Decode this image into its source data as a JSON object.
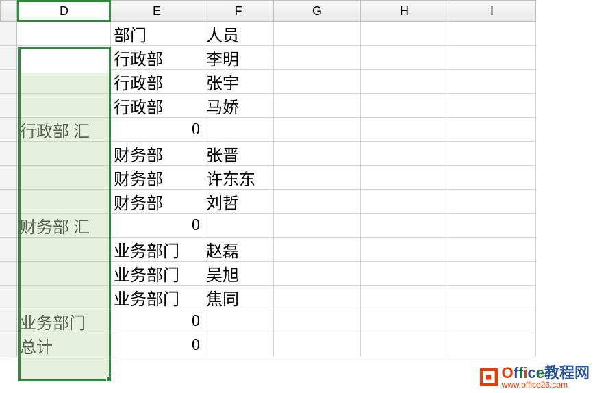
{
  "columns": [
    "",
    "D",
    "E",
    "F",
    "G",
    "H",
    "I"
  ],
  "selected_column": "D",
  "rows": [
    {
      "d": "",
      "e": "部门",
      "f": "人员"
    },
    {
      "d": "",
      "e": "行政部",
      "f": "李明"
    },
    {
      "d": "",
      "e": "行政部",
      "f": "张宇"
    },
    {
      "d": "",
      "e": "行政部",
      "f": "马娇"
    },
    {
      "d": "行政部 汇",
      "e": "0",
      "f": "",
      "e_num": true
    },
    {
      "d": "",
      "e": "财务部",
      "f": "张晋"
    },
    {
      "d": "",
      "e": "财务部",
      "f": "许东东"
    },
    {
      "d": "",
      "e": "财务部",
      "f": "刘哲"
    },
    {
      "d": "财务部 汇",
      "e": "0",
      "f": "",
      "e_num": true
    },
    {
      "d": "",
      "e": "业务部门",
      "f": "赵磊"
    },
    {
      "d": "",
      "e": "业务部门",
      "f": "吴旭"
    },
    {
      "d": "",
      "e": "业务部门",
      "f": "焦同"
    },
    {
      "d": "业务部门",
      "e": "0",
      "f": "",
      "e_num": true
    },
    {
      "d": "总计",
      "e": "0",
      "f": "",
      "e_num": true
    }
  ],
  "watermark": {
    "title": "Office教程网",
    "url": "www.office26.com"
  }
}
